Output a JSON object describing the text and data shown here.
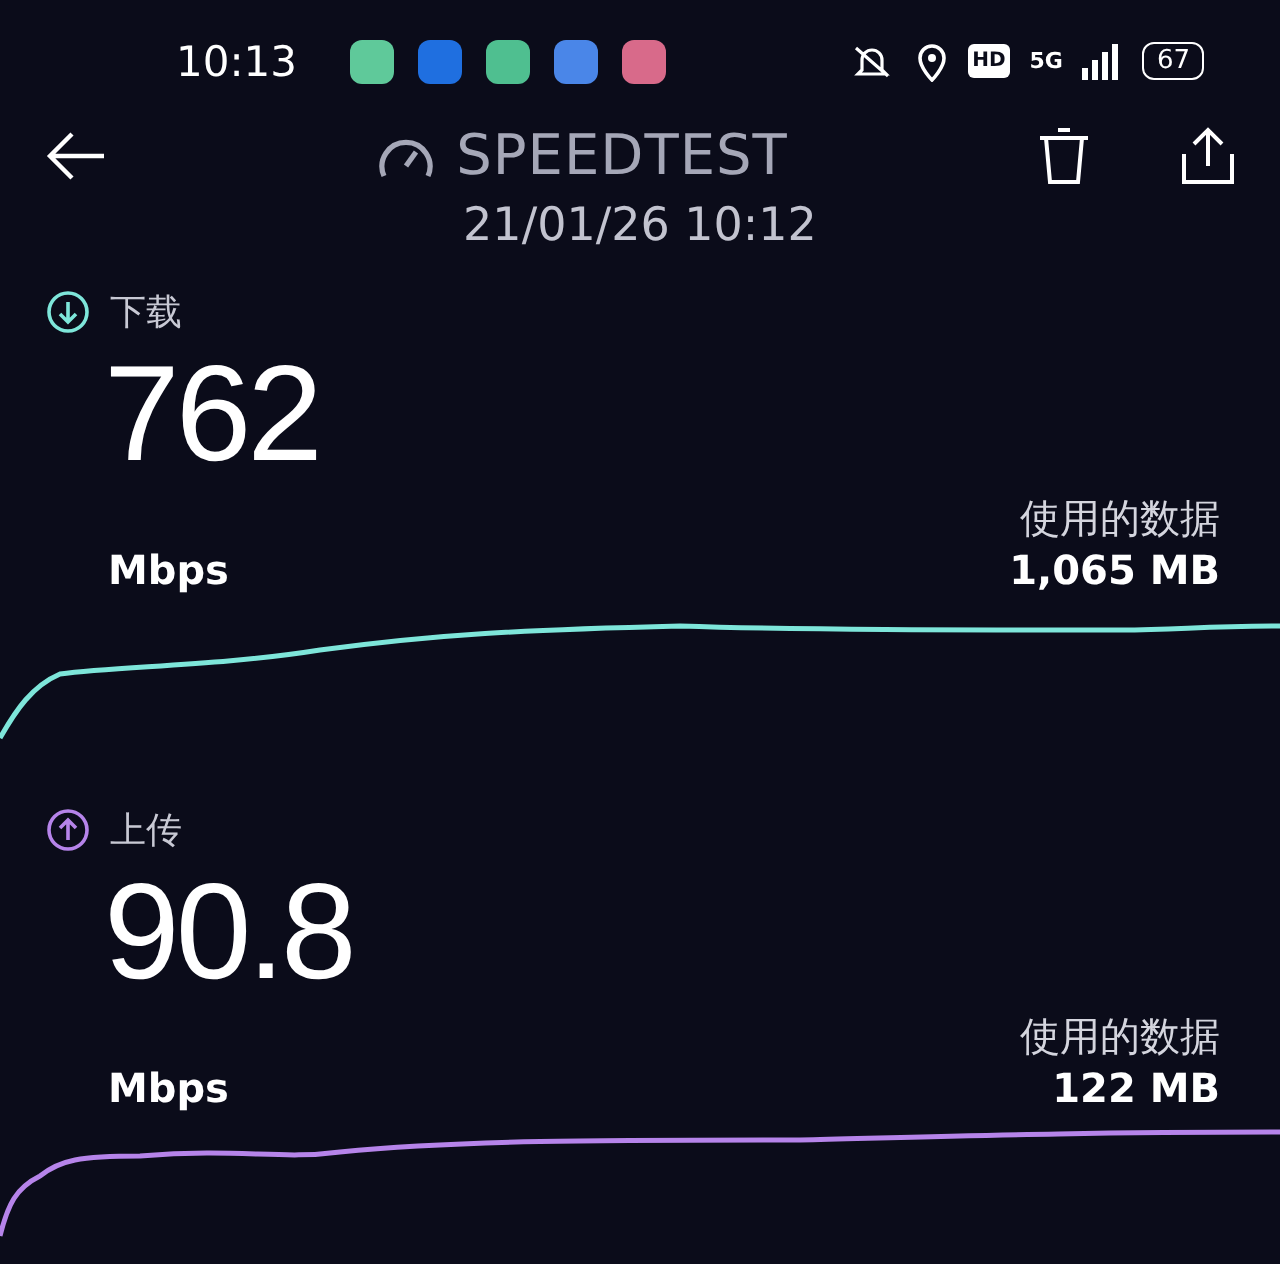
{
  "status_bar": {
    "time": "10:13",
    "hd": "HD",
    "network": "5G",
    "battery": "67"
  },
  "header": {
    "title": "SPEEDTEST",
    "date": "21/01/26 10:12"
  },
  "results": [
    {
      "kind": "download",
      "label": "下载",
      "value": "762",
      "unit": "Mbps",
      "data_label": "使用的数据",
      "data_value": "1,065 MB",
      "color": "#7ee6da"
    },
    {
      "kind": "upload",
      "label": "上传",
      "value": "90.8",
      "unit": "Mbps",
      "data_label": "使用的数据",
      "data_value": "122 MB",
      "color": "#b684ea"
    }
  ]
}
